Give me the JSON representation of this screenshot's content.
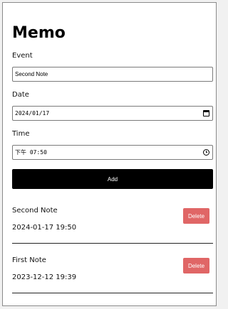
{
  "app": {
    "title": "Memo"
  },
  "form": {
    "event_label": "Event",
    "event_value": "Second Note",
    "date_label": "Date",
    "date_value": "2024/01/17",
    "time_label": "Time",
    "time_value": "下午 07:50",
    "add_label": "Add"
  },
  "memos": [
    {
      "title": "Second Note",
      "datetime": "2024-01-17 19:50",
      "delete_label": "Delete"
    },
    {
      "title": "First Note",
      "datetime": "2023-12-12 19:39",
      "delete_label": "Delete"
    }
  ],
  "colors": {
    "add_button": "#000000",
    "delete_button": "#e06666"
  }
}
